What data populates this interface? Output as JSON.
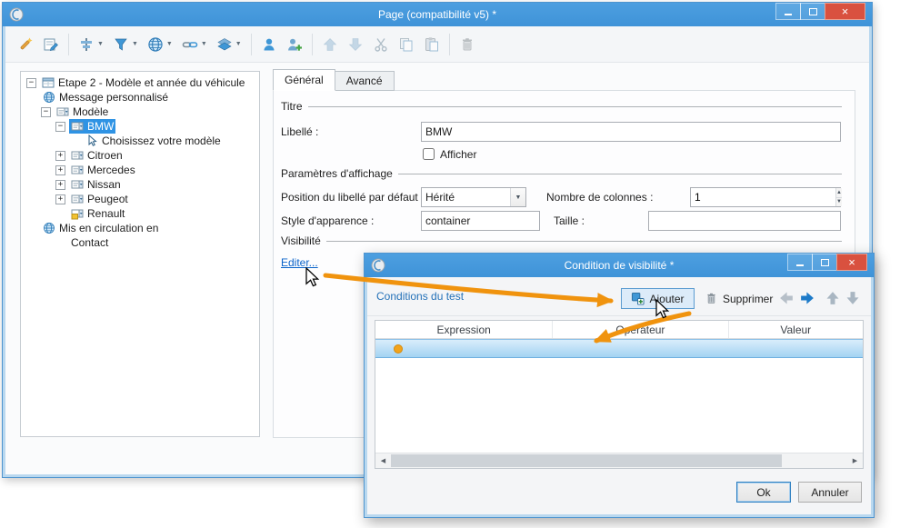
{
  "colors": {
    "accent": "#3f93d8",
    "selection": "#2f93e4",
    "annotation_orange": "#f0930e",
    "link_blue": "#0a63c9"
  },
  "main_window": {
    "title": "Page (compatibilité v5) *",
    "toolbar": [
      {
        "type": "button",
        "name": "wand-icon"
      },
      {
        "type": "button",
        "name": "design-icon"
      },
      {
        "type": "sep"
      },
      {
        "type": "dropdown",
        "name": "align-icon"
      },
      {
        "type": "dropdown",
        "name": "field-icon"
      },
      {
        "type": "dropdown",
        "name": "globe-icon"
      },
      {
        "type": "dropdown",
        "name": "link-icon"
      },
      {
        "type": "dropdown",
        "name": "layers-icon"
      },
      {
        "type": "sep"
      },
      {
        "type": "button",
        "name": "user-icon"
      },
      {
        "type": "button",
        "name": "user-add-icon"
      },
      {
        "type": "sep"
      },
      {
        "type": "button",
        "name": "move-up-icon",
        "disabled": true
      },
      {
        "type": "button",
        "name": "move-down-icon",
        "disabled": true
      },
      {
        "type": "button",
        "name": "cut-icon",
        "disabled": true
      },
      {
        "type": "button",
        "name": "copy-icon",
        "disabled": true
      },
      {
        "type": "button",
        "name": "paste-icon",
        "disabled": true
      },
      {
        "type": "sep"
      },
      {
        "type": "button",
        "name": "trash-icon",
        "disabled": true
      }
    ],
    "tree": {
      "items": [
        {
          "indent": 0,
          "exp": "-",
          "icon": "form-icon",
          "label": "Etape 2 - Modèle et année du véhicule"
        },
        {
          "indent": 1,
          "exp": "",
          "icon": "globe-icon",
          "label": "Message personnalisé"
        },
        {
          "indent": 1,
          "exp": "-",
          "icon": "combo-icon",
          "label": "Modèle"
        },
        {
          "indent": 2,
          "exp": "-",
          "icon": "combo-icon",
          "label": "BMW",
          "selected": true
        },
        {
          "indent": 3,
          "exp": "",
          "icon": "pointer-icon",
          "label": "Choisissez votre modèle"
        },
        {
          "indent": 2,
          "exp": "+",
          "icon": "combo-icon",
          "label": "Citroen"
        },
        {
          "indent": 2,
          "exp": "+",
          "icon": "combo-icon",
          "label": "Mercedes"
        },
        {
          "indent": 2,
          "exp": "+",
          "icon": "combo-icon",
          "label": "Nissan"
        },
        {
          "indent": 2,
          "exp": "+",
          "icon": "combo-icon",
          "label": "Peugeot"
        },
        {
          "indent": 2,
          "exp": "",
          "icon": "combo-warning-icon",
          "label": "Renault"
        },
        {
          "indent": 1,
          "exp": "",
          "icon": "globe-icon",
          "label": "Mis en circulation en"
        },
        {
          "indent": 2,
          "exp": "",
          "icon": "none",
          "label": "Contact"
        }
      ]
    },
    "tabs": [
      {
        "label": "Général",
        "active": true
      },
      {
        "label": "Avancé",
        "active": false
      }
    ],
    "form": {
      "group_titre": "Titre",
      "libelle_label": "Libellé :",
      "libelle_value": "BMW",
      "afficher_label": "Afficher",
      "afficher_checked": false,
      "group_affichage": "Paramètres d'affichage",
      "position_label": "Position du libellé par défaut :",
      "position_value": "Hérité",
      "colonnes_label": "Nombre de colonnes :",
      "colonnes_value": "1",
      "style_label": "Style d'apparence :",
      "style_value": "container",
      "taille_label": "Taille :",
      "taille_value": "",
      "group_visibilite": "Visibilité",
      "editer_label": "Editer..."
    }
  },
  "dialog": {
    "title": "Condition de visibilité *",
    "toolbar": {
      "conditions_label": "Conditions du test",
      "ajouter_label": "Ajouter",
      "supprimer_label": "Supprimer"
    },
    "table": {
      "columns": [
        "Expression",
        "Opérateur",
        "Valeur"
      ],
      "rows": [
        {
          "selected": true,
          "marker": "orange-dot",
          "cells": [
            "",
            "",
            ""
          ]
        }
      ]
    },
    "buttons": {
      "ok": "Ok",
      "annuler": "Annuler"
    }
  }
}
